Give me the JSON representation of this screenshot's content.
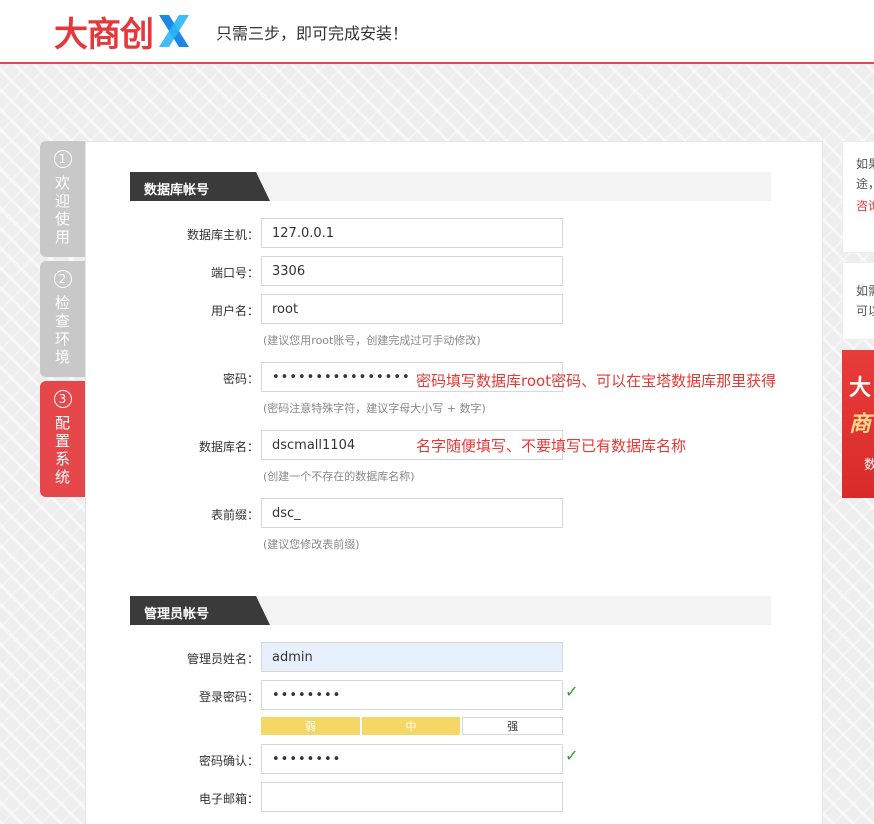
{
  "header": {
    "logo_text": "大商创",
    "tagline": "只需三步，即可完成安装！"
  },
  "steps": [
    {
      "num": "1",
      "label": "欢迎使用"
    },
    {
      "num": "2",
      "label": "检查环境"
    },
    {
      "num": "3",
      "label": "配置系统"
    }
  ],
  "db_section": {
    "title": "数据库帐号",
    "host_label": "数据库主机：",
    "host_value": "127.0.0.1",
    "port_label": "端口号：",
    "port_value": "3306",
    "user_label": "用户名：",
    "user_value": "root",
    "user_hint": "(建议您用root账号，创建完成过可手动修改)",
    "pass_label": "密码：",
    "pass_value": "••••••••••••••••",
    "pass_hint": "(密码注意特殊字符，建议字母大小写 + 数字)",
    "pass_annotation": "密码填写数据库root密码、可以在宝塔数据库那里获得",
    "dbname_label": "数据库名：",
    "dbname_value": "dscmall1104",
    "dbname_hint": "(创建一个不存在的数据库名称)",
    "dbname_annotation": "名字随便填写、不要填写已有数据库名称",
    "prefix_label": "表前缀：",
    "prefix_value": "dsc_",
    "prefix_hint": "(建议您修改表前缀)"
  },
  "admin_section": {
    "title": "管理员帐号",
    "name_label": "管理员姓名：",
    "name_value": "admin",
    "pass_label": "登录密码：",
    "pass_value": "••••••••",
    "strength": {
      "weak": "弱",
      "medium": "中",
      "strong": "强"
    },
    "confirm_label": "密码确认：",
    "confirm_value": "••••••••",
    "email_label": "电子邮箱：",
    "email_value": "",
    "check_mark": "✓"
  },
  "side": {
    "card1_line1": "如果",
    "card1_line2": "途，",
    "card1_link": "咨询",
    "card2_line1": "如需",
    "card2_line2": "可以",
    "banner_line1": "大",
    "banner_line2": "商",
    "banner_line3": "数"
  },
  "colors": {
    "accent": "#e5383b",
    "step_active": "#e5474b",
    "step_inactive": "#c8c8c8",
    "check": "#2e9b3f",
    "strength_on": "#f5d766"
  }
}
